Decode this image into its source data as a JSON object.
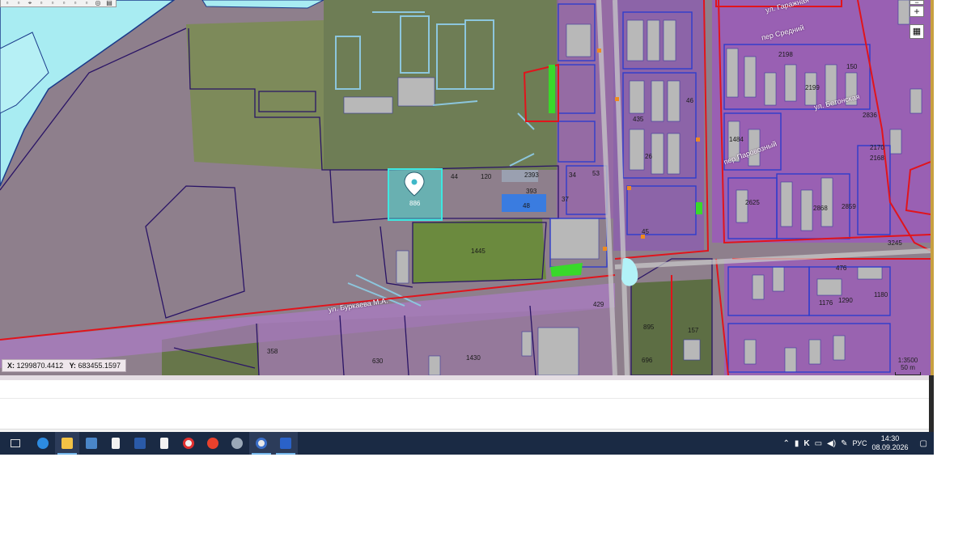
{
  "map": {
    "coords": {
      "x_label": "X:",
      "x_value": "1299870.4412",
      "y_label": "Y:",
      "y_value": "683455.1597"
    },
    "scale": {
      "ratio": "1:3500",
      "distance": "50 m"
    },
    "zoom": {
      "in": "+",
      "out": "−"
    },
    "streets": [
      "ул. Буркаева М.А.",
      "пер Средний",
      "ул. Гаражная",
      "ул. Бетонская",
      "пер Паровозный"
    ],
    "parcel_numbers": [
      "886",
      "1445",
      "120",
      "44",
      "393",
      "2393",
      "48",
      "37",
      "53",
      "34",
      "45",
      "46",
      "26",
      "435",
      "429",
      "895",
      "157",
      "696",
      "358",
      "630",
      "1430",
      "2198",
      "2199",
      "2859",
      "3245",
      "1176",
      "1290",
      "1484",
      "2625",
      "2868",
      "2170",
      "476",
      "1180",
      "150",
      "2836",
      "2168"
    ],
    "selected_parcel": "886"
  },
  "taskbar": {
    "icons": [
      "task-view-icon",
      "ie-icon",
      "explorer-icon",
      "network-icon",
      "document-icon",
      "powershell-icon",
      "file-icon",
      "yandex-browser-icon",
      "yandex-icon",
      "satellite-icon",
      "gis-app-icon",
      "word-icon"
    ],
    "tray": {
      "lang": "РУС",
      "time": "14:30",
      "date": "08.09.2026"
    }
  }
}
